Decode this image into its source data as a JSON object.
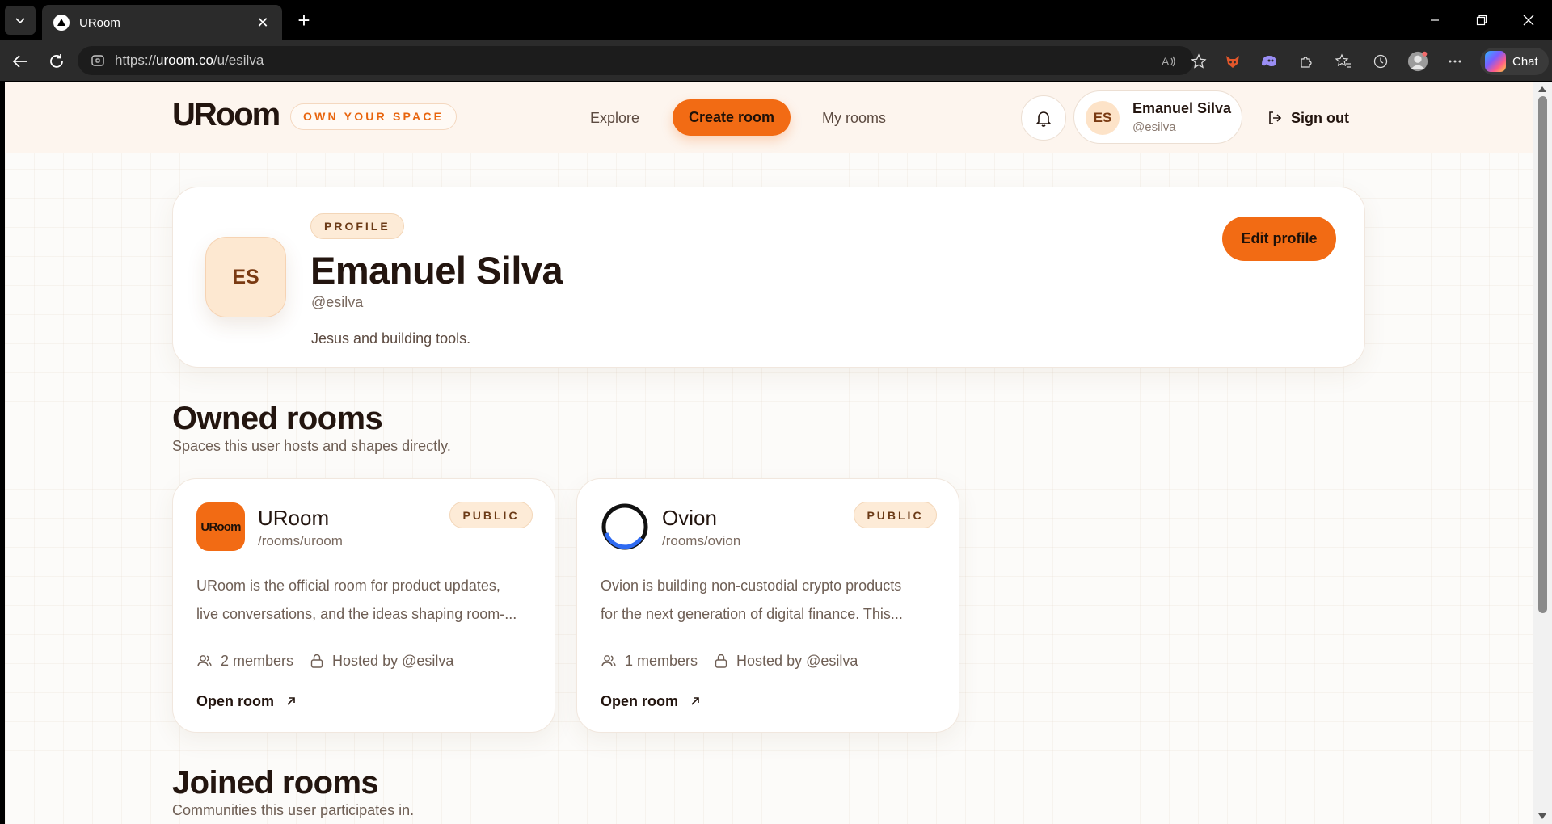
{
  "browser": {
    "tab_title": "URoom",
    "url_scheme": "https://",
    "url_host": "uroom.co",
    "url_path": "/u/esilva",
    "chat_label": "Chat"
  },
  "header": {
    "logo": "URoom",
    "tagline": "OWN YOUR SPACE",
    "nav": {
      "explore": "Explore",
      "create_room": "Create room",
      "my_rooms": "My rooms"
    },
    "user": {
      "initials": "ES",
      "name": "Emanuel Silva",
      "handle": "@esilva"
    },
    "sign_out": "Sign out"
  },
  "profile": {
    "badge": "PROFILE",
    "initials": "ES",
    "name": "Emanuel Silva",
    "handle": "@esilva",
    "bio": "Jesus and building tools.",
    "edit_label": "Edit profile"
  },
  "owned": {
    "title": "Owned rooms",
    "subtitle": "Spaces this user hosts and shapes directly.",
    "rooms": [
      {
        "logo_text": "URoom",
        "name": "URoom",
        "path": "/rooms/uroom",
        "badge": "PUBLIC",
        "desc_line1": "URoom is the official room for product updates,",
        "desc_line2": "live conversations, and the ideas shaping room-...",
        "members": "2 members",
        "host": "Hosted by @esilva",
        "open_label": "Open room"
      },
      {
        "name": "Ovion",
        "path": "/rooms/ovion",
        "badge": "PUBLIC",
        "desc_line1": "Ovion is building non-custodial crypto products",
        "desc_line2": "for the next generation of digital finance. This...",
        "members": "1 members",
        "host": "Hosted by @esilva",
        "open_label": "Open room"
      }
    ]
  },
  "joined": {
    "title": "Joined rooms",
    "subtitle": "Communities this user participates in."
  },
  "colors": {
    "accent": "#f26b14",
    "page_bg": "#fcfbf9",
    "header_bg": "#fdf5ee",
    "text_dark": "#23150f"
  }
}
